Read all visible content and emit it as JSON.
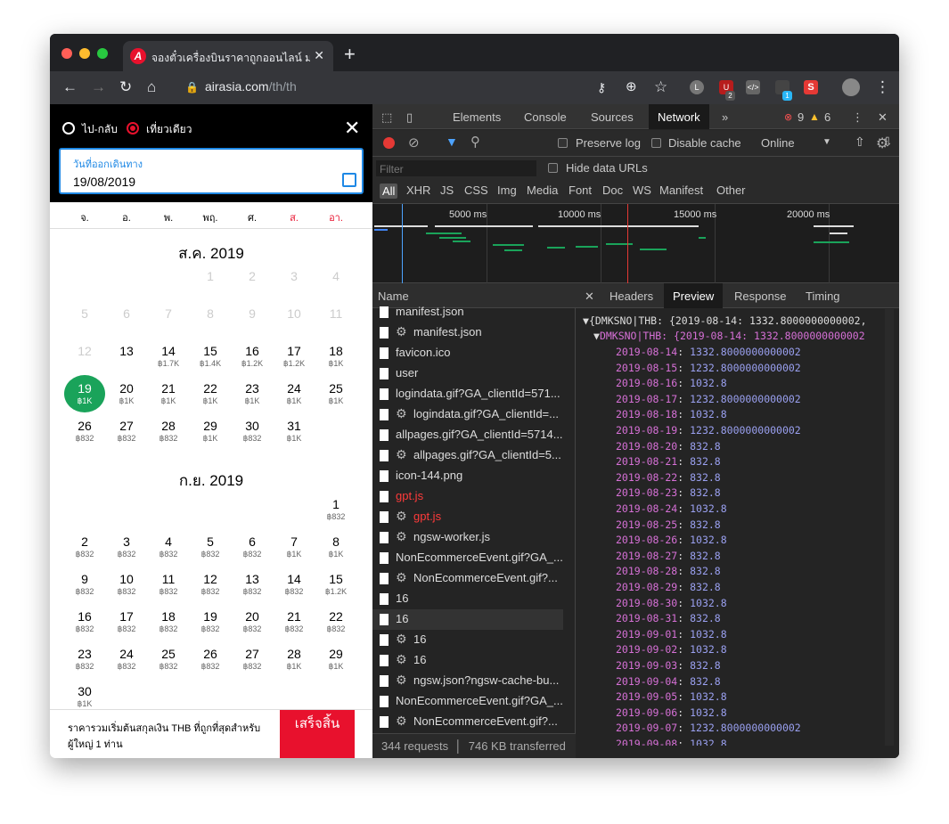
{
  "browser": {
    "tab_title": "จองตั๋วเครื่องบินราคาถูกออนไลน์ มา",
    "tab_close": "✕",
    "new_tab": "+",
    "url_host": "airasia.com",
    "url_path": "/th/th",
    "ext_badge_1": "2",
    "ext_badge_2": "1"
  },
  "site": {
    "trip_roundtrip": "ไป-กลับ",
    "trip_oneway": "เที่ยวเดียว",
    "date_label": "วันที่ออกเดินทาง",
    "date_value": "19/08/2019",
    "weekdays": [
      "จ.",
      "อ.",
      "พ.",
      "พฤ.",
      "ศ.",
      "ส.",
      "อา."
    ],
    "months": [
      "ส.ค. 2019",
      "ก.ย. 2019"
    ],
    "footer_text": "ราคารวมเริ่มต้นสกุลเงิน THB ที่ถูกที่สุดสำหรับผู้ใหญ่ 1 ท่าน",
    "done_button": "เสร็จสิ้น"
  },
  "devtools": {
    "tabs": [
      "Elements",
      "Console",
      "Sources",
      "Network"
    ],
    "more": "»",
    "errors": "9",
    "warnings": "6",
    "preserve_log": "Preserve log",
    "disable_cache": "Disable cache",
    "throttle": "Online",
    "filter_placeholder": "Filter",
    "hide_data_urls": "Hide data URLs",
    "types": [
      "All",
      "XHR",
      "JS",
      "CSS",
      "Img",
      "Media",
      "Font",
      "Doc",
      "WS",
      "Manifest",
      "Other"
    ],
    "ticks": [
      "5000 ms",
      "10000 ms",
      "15000 ms",
      "20000 ms"
    ],
    "name_header": "Name",
    "status_requests": "344 requests",
    "status_transferred": "746 KB transferred",
    "preview_tabs": [
      "Headers",
      "Preview",
      "Response",
      "Timing"
    ],
    "json_root": "{DMKSNO|THB: {2019-08-14: 1332.8000000000002,",
    "json_child": "DMKSNO|THB: {2019-08-14: 1332.8000000000002"
  },
  "requests": [
    {
      "name": "manifest.json",
      "gear": false,
      "err": false
    },
    {
      "name": "manifest.json",
      "gear": true,
      "err": false
    },
    {
      "name": "favicon.ico",
      "gear": false,
      "err": false
    },
    {
      "name": "user",
      "gear": false,
      "err": false
    },
    {
      "name": "logindata.gif?GA_clientId=571...",
      "gear": false,
      "err": false
    },
    {
      "name": "logindata.gif?GA_clientId=...",
      "gear": true,
      "err": false
    },
    {
      "name": "allpages.gif?GA_clientId=5714...",
      "gear": false,
      "err": false
    },
    {
      "name": "allpages.gif?GA_clientId=5...",
      "gear": true,
      "err": false
    },
    {
      "name": "icon-144.png",
      "gear": false,
      "err": false
    },
    {
      "name": "gpt.js",
      "gear": false,
      "err": true
    },
    {
      "name": "gpt.js",
      "gear": true,
      "err": true
    },
    {
      "name": "ngsw-worker.js",
      "gear": true,
      "err": false
    },
    {
      "name": "NonEcommerceEvent.gif?GA_...",
      "gear": false,
      "err": false
    },
    {
      "name": "NonEcommerceEvent.gif?...",
      "gear": true,
      "err": false
    },
    {
      "name": "16",
      "gear": false,
      "err": false
    },
    {
      "name": "16",
      "gear": false,
      "err": false
    },
    {
      "name": "16",
      "gear": true,
      "err": false
    },
    {
      "name": "16",
      "gear": true,
      "err": false
    },
    {
      "name": "ngsw.json?ngsw-cache-bu...",
      "gear": true,
      "err": false
    },
    {
      "name": "NonEcommerceEvent.gif?GA_...",
      "gear": false,
      "err": false
    },
    {
      "name": "NonEcommerceEvent.gif?...",
      "gear": true,
      "err": false
    }
  ],
  "prices": [
    {
      "date": "2019-08-14",
      "value": "1332.8000000000002"
    },
    {
      "date": "2019-08-15",
      "value": "1232.8000000000002"
    },
    {
      "date": "2019-08-16",
      "value": "1032.8"
    },
    {
      "date": "2019-08-17",
      "value": "1232.8000000000002"
    },
    {
      "date": "2019-08-18",
      "value": "1032.8"
    },
    {
      "date": "2019-08-19",
      "value": "1232.8000000000002"
    },
    {
      "date": "2019-08-20",
      "value": "832.8"
    },
    {
      "date": "2019-08-21",
      "value": "832.8"
    },
    {
      "date": "2019-08-22",
      "value": "832.8"
    },
    {
      "date": "2019-08-23",
      "value": "832.8"
    },
    {
      "date": "2019-08-24",
      "value": "1032.8"
    },
    {
      "date": "2019-08-25",
      "value": "832.8"
    },
    {
      "date": "2019-08-26",
      "value": "1032.8"
    },
    {
      "date": "2019-08-27",
      "value": "832.8"
    },
    {
      "date": "2019-08-28",
      "value": "832.8"
    },
    {
      "date": "2019-08-29",
      "value": "832.8"
    },
    {
      "date": "2019-08-30",
      "value": "1032.8"
    },
    {
      "date": "2019-08-31",
      "value": "832.8"
    },
    {
      "date": "2019-09-01",
      "value": "1032.8"
    },
    {
      "date": "2019-09-02",
      "value": "1032.8"
    },
    {
      "date": "2019-09-03",
      "value": "832.8"
    },
    {
      "date": "2019-09-04",
      "value": "832.8"
    },
    {
      "date": "2019-09-05",
      "value": "1032.8"
    },
    {
      "date": "2019-09-06",
      "value": "1032.8"
    },
    {
      "date": "2019-09-07",
      "value": "1232.8000000000002"
    },
    {
      "date": "2019-09-08",
      "value": "1032.8"
    }
  ],
  "aug_days": [
    {
      "d": "1",
      "p": "",
      "dis": true
    },
    {
      "d": "2",
      "p": "",
      "dis": true
    },
    {
      "d": "3",
      "p": "",
      "dis": true
    },
    {
      "d": "4",
      "p": "",
      "dis": true
    },
    {
      "d": "5",
      "p": "",
      "dis": true
    },
    {
      "d": "6",
      "p": "",
      "dis": true
    },
    {
      "d": "7",
      "p": "",
      "dis": true
    },
    {
      "d": "8",
      "p": "",
      "dis": true
    },
    {
      "d": "9",
      "p": "",
      "dis": true
    },
    {
      "d": "10",
      "p": "",
      "dis": true
    },
    {
      "d": "11",
      "p": "",
      "dis": true
    },
    {
      "d": "12",
      "p": "",
      "dis": true
    },
    {
      "d": "13",
      "p": ""
    },
    {
      "d": "14",
      "p": "฿1.7K"
    },
    {
      "d": "15",
      "p": "฿1.4K"
    },
    {
      "d": "16",
      "p": "฿1.2K"
    },
    {
      "d": "17",
      "p": "฿1.2K"
    },
    {
      "d": "18",
      "p": "฿1K"
    },
    {
      "d": "19",
      "p": "฿1K",
      "sel": true
    },
    {
      "d": "20",
      "p": "฿1K"
    },
    {
      "d": "21",
      "p": "฿1K"
    },
    {
      "d": "22",
      "p": "฿1K"
    },
    {
      "d": "23",
      "p": "฿1K"
    },
    {
      "d": "24",
      "p": "฿1K"
    },
    {
      "d": "25",
      "p": "฿1K"
    },
    {
      "d": "26",
      "p": "฿832"
    },
    {
      "d": "27",
      "p": "฿832"
    },
    {
      "d": "28",
      "p": "฿832"
    },
    {
      "d": "29",
      "p": "฿1K"
    },
    {
      "d": "30",
      "p": "฿832"
    },
    {
      "d": "31",
      "p": "฿1K"
    }
  ],
  "sep_days": [
    {
      "d": "1",
      "p": "฿832"
    },
    {
      "d": "2",
      "p": "฿832"
    },
    {
      "d": "3",
      "p": "฿832"
    },
    {
      "d": "4",
      "p": "฿832"
    },
    {
      "d": "5",
      "p": "฿832"
    },
    {
      "d": "6",
      "p": "฿832"
    },
    {
      "d": "7",
      "p": "฿1K"
    },
    {
      "d": "8",
      "p": "฿1K"
    },
    {
      "d": "9",
      "p": "฿832"
    },
    {
      "d": "10",
      "p": "฿832"
    },
    {
      "d": "11",
      "p": "฿832"
    },
    {
      "d": "12",
      "p": "฿832"
    },
    {
      "d": "13",
      "p": "฿832"
    },
    {
      "d": "14",
      "p": "฿832"
    },
    {
      "d": "15",
      "p": "฿1.2K"
    },
    {
      "d": "16",
      "p": "฿832"
    },
    {
      "d": "17",
      "p": "฿832"
    },
    {
      "d": "18",
      "p": "฿832"
    },
    {
      "d": "19",
      "p": "฿832"
    },
    {
      "d": "20",
      "p": "฿832"
    },
    {
      "d": "21",
      "p": "฿832"
    },
    {
      "d": "22",
      "p": "฿832"
    },
    {
      "d": "23",
      "p": "฿832"
    },
    {
      "d": "24",
      "p": "฿832"
    },
    {
      "d": "25",
      "p": "฿832"
    },
    {
      "d": "26",
      "p": "฿832"
    },
    {
      "d": "27",
      "p": "฿832"
    },
    {
      "d": "28",
      "p": "฿1K"
    },
    {
      "d": "29",
      "p": "฿1K"
    },
    {
      "d": "30",
      "p": "฿1K"
    }
  ]
}
